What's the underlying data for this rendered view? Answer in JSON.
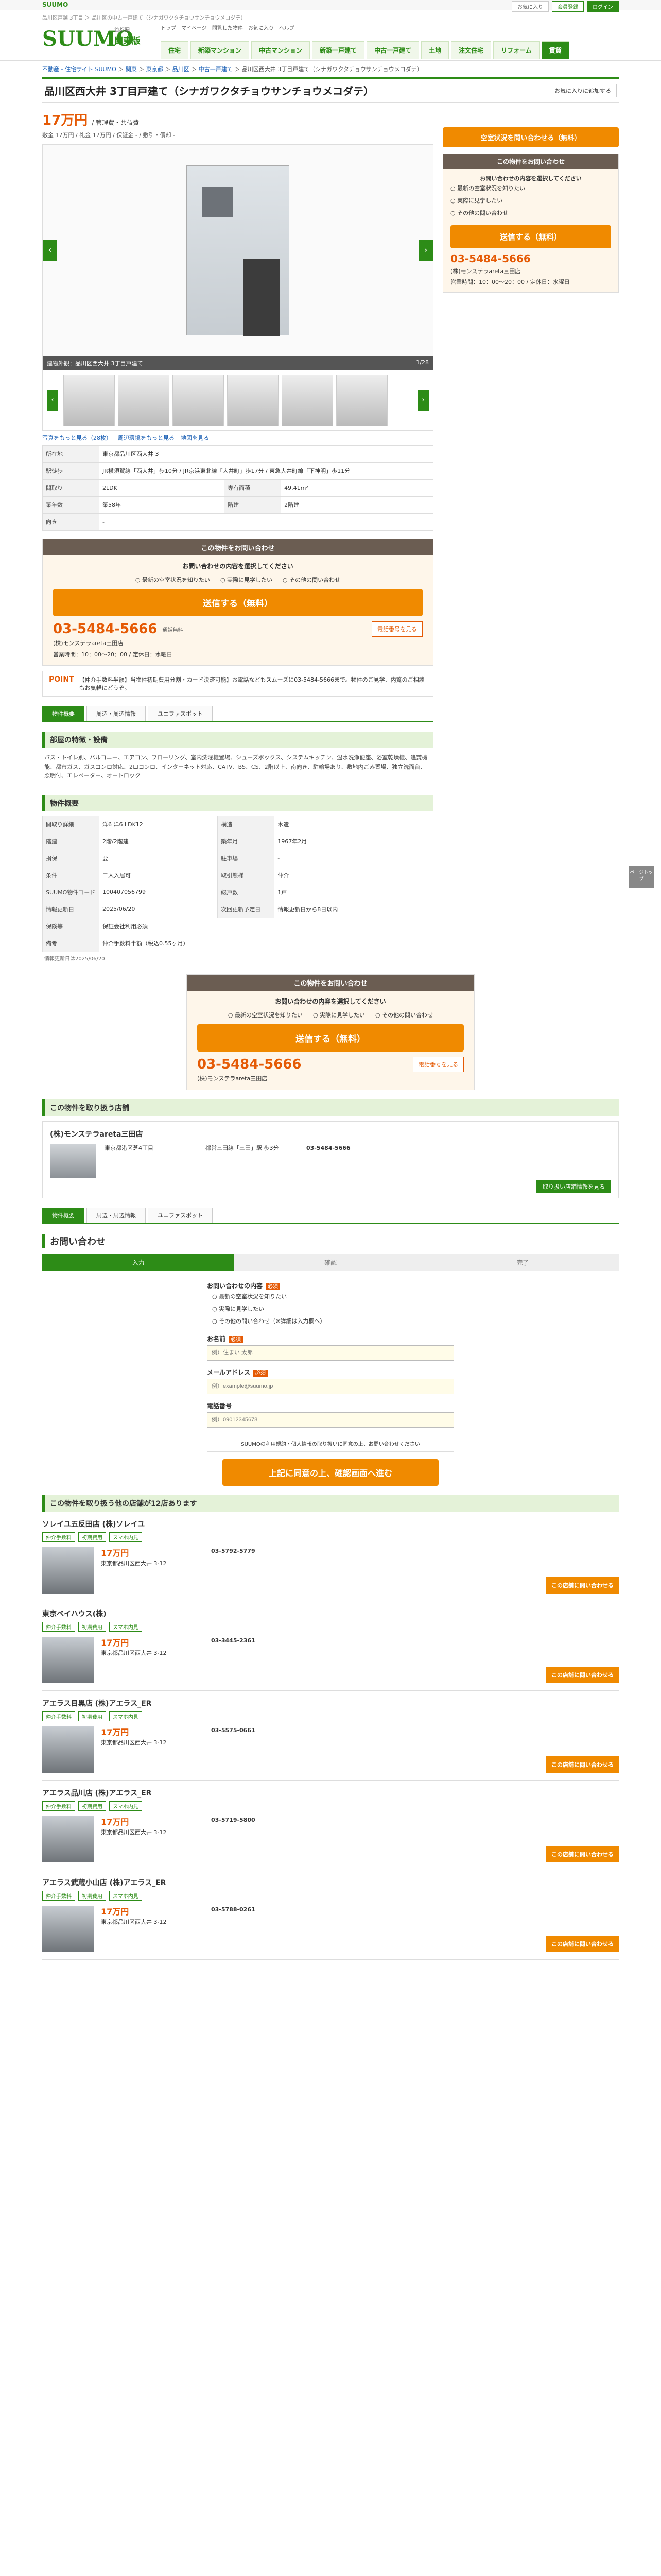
{
  "topstrip": {
    "logo": "SUUMO",
    "links": [
      "会員登録",
      "ログイン"
    ],
    "fav": "お気に入り"
  },
  "header": {
    "desc": "品川区戸越 3丁目 ＞ 品川区の中古一戸建て（シナガワクタチョウサンチョウメコダテ）",
    "brand": "SUUMO",
    "region": "関東版",
    "region_sub": "首都圏",
    "util": [
      "トップ",
      "マイページ",
      "閲覧した物件",
      "お気に入り",
      "ヘルプ"
    ],
    "nav": [
      "住宅",
      "新築マンション",
      "中古マンション",
      "新築一戸建て",
      "中古一戸建て",
      "土地",
      "注文住宅",
      "リフォーム",
      "賃貸"
    ]
  },
  "breadcrumb": [
    "不動産・住宅サイト SUUMO",
    "関東",
    "東京都",
    "品川区",
    "中古一戸建て",
    "品川区西大井 3丁目戸建て（シナガワクタチョウサンチョウメコダテ）"
  ],
  "title": "品川区西大井 3丁目戸建て（シナガワクタチョウサンチョウメコダテ）",
  "fav_button": "お気に入りに追加する",
  "price": {
    "amount": "17万円",
    "sub": "/ 管理費・共益費 -",
    "meta": "敷金 17万円 / 礼金 17万円 / 保証金 - / 敷引・償却 -"
  },
  "free_inquiry": "空室状況を問い合わせる（無料）",
  "gallery": {
    "caption": "建物外観：品川区西大井 3丁目戸建て",
    "counter": "1/28",
    "prev": "‹",
    "next": "›"
  },
  "photo_links": [
    "写真をもっと見る（28枚）",
    "周辺環境をもっと見る",
    "地図を見る"
  ],
  "spec": [
    {
      "k": "所在地",
      "v": "東京都品川区西大井 3",
      "k2": "",
      "v2": ""
    },
    {
      "k": "駅徒歩",
      "v": "JR横須賀線「西大井」歩10分 / JR京浜東北線「大井町」歩17分 / 東急大井町線「下神明」歩11分",
      "k2": "",
      "v2": ""
    },
    {
      "k": "間取り",
      "v": "2LDK",
      "k2": "専有面積",
      "v2": "49.41m²"
    },
    {
      "k": "築年数",
      "v": "築58年",
      "k2": "階建",
      "v2": "2階建"
    },
    {
      "k": "向き",
      "v": "-",
      "k2": "",
      "v2": ""
    }
  ],
  "inquiry": {
    "heading": "この物件をお問い合わせ",
    "question": "お問い合わせの内容を選択してください",
    "options": [
      "最新の空室状況を知りたい",
      "実際に見学したい",
      "その他の問い合わせ"
    ],
    "send": "送信する（無料）",
    "tel": "03-5484-5666",
    "tel_hint": "通話無料",
    "tel_button": "電話番号を見る",
    "shop": "(株)モンステラareta三田店",
    "hours": "営業時間：10：00〜20：00 / 定休日：水曜日"
  },
  "point": {
    "label": "POINT",
    "text": "【仲介手数料半額】当物件初期費用分割・カード決済可能】お電話などもスムーズに03-5484-5666まで。物件のご見学、内覧のご相談もお気軽にどうぞ。"
  },
  "tabs": [
    "物件概要",
    "周辺・周辺情報",
    "ユニファスポット"
  ],
  "features": {
    "heading": "部屋の特徴・設備",
    "text": "バス・トイレ別、バルコニー、エアコン、フローリング、室内洗濯機置場、シューズボックス、システムキッチン、温水洗浄便座、浴室乾燥機、追焚機能、都市ガス、ガスコンロ対応、2口コンロ、インターネット対応、CATV、BS、CS、2階以上、南向き、駐輪場あり、敷地内ごみ置場、独立洗面台、照明付、エレベーター、オートロック"
  },
  "overview": {
    "heading": "物件概要",
    "rows": [
      {
        "k": "間取り詳細",
        "v": "洋6 洋6 LDK12",
        "k2": "構造",
        "v2": "木造"
      },
      {
        "k": "階建",
        "v": "2階/2階建",
        "k2": "築年月",
        "v2": "1967年2月"
      },
      {
        "k": "損保",
        "v": "要",
        "k2": "駐車場",
        "v2": "-"
      },
      {
        "k": "条件",
        "v": "二人入居可",
        "k2": "取引態様",
        "v2": "仲介"
      },
      {
        "k": "SUUMO物件コード",
        "v": "100407056799",
        "k2": "総戸数",
        "v2": "1戸"
      },
      {
        "k": "情報更新日",
        "v": "2025/06/20",
        "k2": "次回更新予定日",
        "v2": "情報更新日から8日以内"
      },
      {
        "k": "保険等",
        "v": "保証会社利用必須",
        "k2": "",
        "v2": ""
      },
      {
        "k": "備考",
        "v": "仲介手数料半額（税込0.55ヶ月）",
        "k2": "",
        "v2": ""
      }
    ],
    "note": "情報更新日は2025/06/20"
  },
  "shop": {
    "heading": "この物件を取り扱う店舗",
    "name": "(株)モンステラareta三田店",
    "address": "東京都港区芝4丁目",
    "access": "都営三田線「三田」駅 歩3分",
    "tel": "03-5484-5666",
    "more": "取り扱い店舗情報を見る"
  },
  "form": {
    "title": "お問い合わせ",
    "steps": [
      "入力",
      "確認",
      "完了"
    ],
    "q1": "お問い合わせの内容",
    "options": [
      "最新の空室状況を知りたい",
      "実際に見学したい",
      "その他の問い合わせ（※詳細は入力欄へ）"
    ],
    "name_label": "お名前",
    "name_ph": "例）住まい 太郎",
    "email_label": "メールアドレス",
    "email_ph": "例）example@suumo.jp",
    "tel_label": "電話番号",
    "tel_ph": "例）09012345678",
    "req": "必須",
    "consent": "SUUMOの利用規約・個人情報の取り扱いに同意の上、お問い合わせください",
    "confirm": "上記に同意の上、確認画面へ進む"
  },
  "similar": {
    "heading": "この物件を取り扱う他の店舗が12店あります",
    "items": [
      {
        "name": "ソレイユ五反田店 (株)ソレイユ",
        "tags": [
          "仲介手数料",
          "初期費用",
          "スマホ内見"
        ],
        "price": "17万円",
        "addr": "東京都品川区西大井 3-12",
        "tel": "03-5792-5779",
        "btn": "この店舗に問い合わせる"
      },
      {
        "name": "東京ベイハウス(株)",
        "tags": [
          "仲介手数料",
          "初期費用",
          "スマホ内見"
        ],
        "price": "17万円",
        "addr": "東京都品川区西大井 3-12",
        "tel": "03-3445-2361",
        "btn": "この店舗に問い合わせる"
      },
      {
        "name": "アエラス目黒店 (株)アエラス_ER",
        "tags": [
          "仲介手数料",
          "初期費用",
          "スマホ内見"
        ],
        "price": "17万円",
        "addr": "東京都品川区西大井 3-12",
        "tel": "03-5575-0661",
        "btn": "この店舗に問い合わせる"
      },
      {
        "name": "アエラス品川店 (株)アエラス_ER",
        "tags": [
          "仲介手数料",
          "初期費用",
          "スマホ内見"
        ],
        "price": "17万円",
        "addr": "東京都品川区西大井 3-12",
        "tel": "03-5719-5800",
        "btn": "この店舗に問い合わせる"
      },
      {
        "name": "アエラス武蔵小山店 (株)アエラス_ER",
        "tags": [
          "仲介手数料",
          "初期費用",
          "スマホ内見"
        ],
        "price": "17万円",
        "addr": "東京都品川区西大井 3-12",
        "tel": "03-5788-0261",
        "btn": "この店舗に問い合わせる"
      }
    ]
  },
  "float": "ページトップ"
}
